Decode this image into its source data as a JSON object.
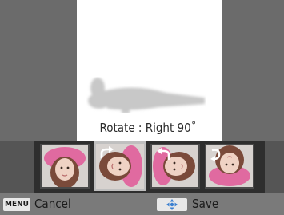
{
  "preview": {
    "caption": "Rotate : Right 90˚"
  },
  "thumbnails": [
    {
      "label": "Original",
      "rotation_deg": 0,
      "icon": "none"
    },
    {
      "label": "Right 90",
      "rotation_deg": 90,
      "icon": "rotate-right-icon",
      "selected": true
    },
    {
      "label": "Left 90",
      "rotation_deg": -90,
      "icon": "rotate-left-icon"
    },
    {
      "label": "180",
      "rotation_deg": 180,
      "icon": "rotate-180-icon"
    }
  ],
  "footer": {
    "menu_key": "MENU",
    "cancel_label": "Cancel",
    "save_label": "Save",
    "save_key_icon": "dpad-icon"
  },
  "colors": {
    "accent_pink": "#e06aa0",
    "background": "#6b6b6b"
  }
}
